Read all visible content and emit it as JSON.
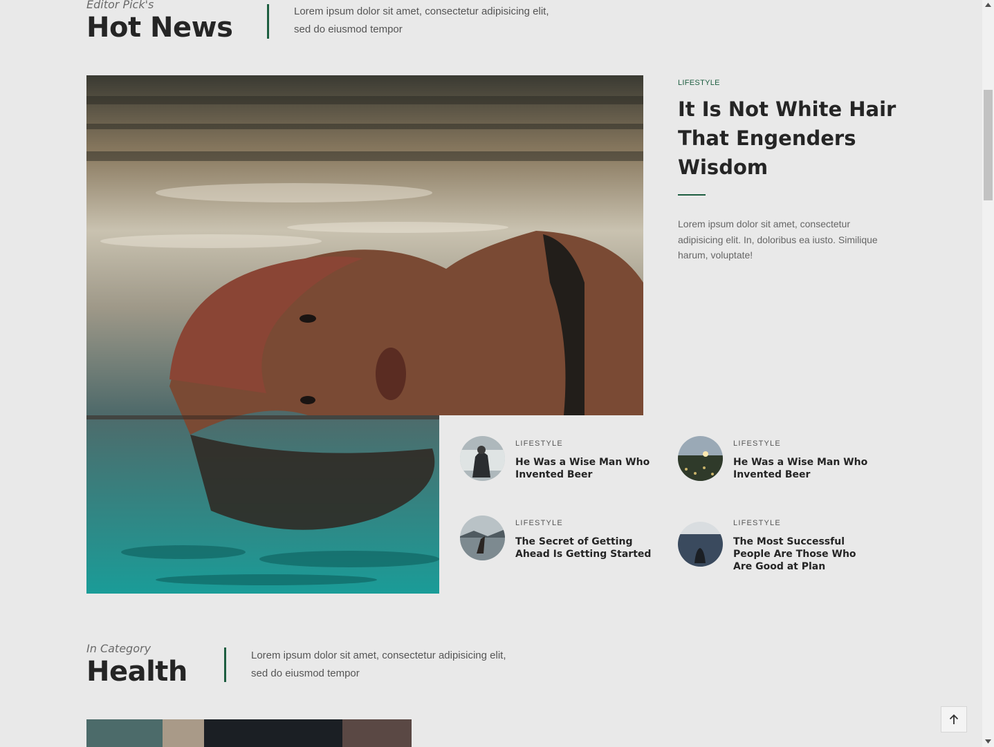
{
  "hot_news": {
    "kicker": "Editor Pick's",
    "title": "Hot News",
    "description": "Lorem ipsum dolor sit amet, consectetur adipisicing elit, sed do eiusmod tempor"
  },
  "lead_article": {
    "category": "LIFESTYLE",
    "title": "It Is Not White Hair That Engenders Wisdom",
    "excerpt": "Lorem ipsum dolor sit amet, consectetur adipisicing elit. In, doloribus ea iusto. Similique harum, voluptate!"
  },
  "cards": [
    {
      "category": "LIFESTYLE",
      "title": "He Was a Wise Man Who Invented Beer"
    },
    {
      "category": "LIFESTYLE",
      "title": "He Was a Wise Man Who Invented Beer"
    },
    {
      "category": "LIFESTYLE",
      "title": "The Secret of Getting Ahead Is Getting Started"
    },
    {
      "category": "LIFESTYLE",
      "title": "The Most Successful People Are Those Who Are Good at Plan"
    }
  ],
  "health": {
    "kicker": "In Category",
    "title": "Health",
    "description": "Lorem ipsum dolor sit amet, consectetur adipisicing elit, sed do eiusmod tempor"
  },
  "icons": {
    "back_to_top": "arrow-up-icon"
  },
  "colors": {
    "accent": "#1d5e40",
    "background": "#e9e9e9"
  }
}
